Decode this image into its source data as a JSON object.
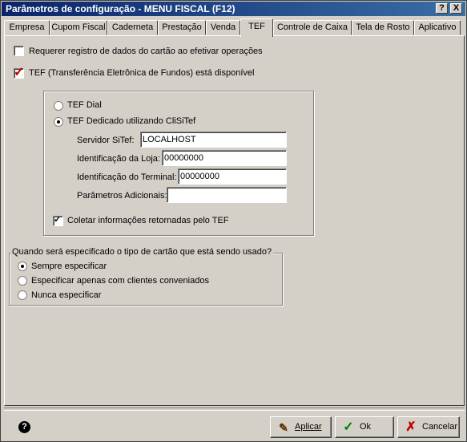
{
  "window": {
    "title": "Parâmetros de configuração - MENU FISCAL (F12)",
    "help_btn": "?",
    "close_btn": "X"
  },
  "tabs": [
    {
      "label": "Empresa"
    },
    {
      "label": "Cupom Fiscal"
    },
    {
      "label": "Caderneta"
    },
    {
      "label": "Prestação"
    },
    {
      "label": "Venda"
    },
    {
      "label": "TEF"
    },
    {
      "label": "Controle de Caixa"
    },
    {
      "label": "Tela de Rosto"
    },
    {
      "label": "Aplicativo"
    }
  ],
  "active_tab": "TEF",
  "options": {
    "require_card_data": {
      "label": "Requerer registro de dados do cartão ao efetivar operações",
      "checked": false
    },
    "tef_available": {
      "label": "TEF (Transferência Eletrônica de Fundos) está disponível",
      "checked": true
    }
  },
  "tef_group": {
    "tef_dial": {
      "label": "TEF Dial",
      "selected": false
    },
    "tef_dedicated": {
      "label": "TEF Dedicado utilizando CliSiTef",
      "selected": true
    },
    "server": {
      "label": "Servidor SiTef:",
      "value": "LOCALHOST"
    },
    "store_id": {
      "label": "Identificação da Loja:",
      "value": "00000000"
    },
    "terminal_id": {
      "label": "Identificação do Terminal:",
      "value": "00000000"
    },
    "extra_params": {
      "label": "Parâmetros Adicionais:",
      "value": ""
    },
    "collect_info": {
      "label": "Coletar informações retornadas pelo TEF",
      "checked": true
    }
  },
  "card_type_group": {
    "legend": "Quando será especificado o tipo de cartão que está sendo usado?",
    "options": [
      {
        "label": "Sempre especificar",
        "selected": true
      },
      {
        "label": "Especificar apenas com clientes conveniados",
        "selected": false
      },
      {
        "label": "Nunca especificar",
        "selected": false
      }
    ]
  },
  "buttons": {
    "apply": "Aplicar",
    "ok": "Ok",
    "cancel": "Cancelar"
  },
  "colors": {
    "title_bar": "#0a246a",
    "check_red": "#c00000",
    "ok_green": "#008000",
    "cancel_red": "#c00000"
  }
}
